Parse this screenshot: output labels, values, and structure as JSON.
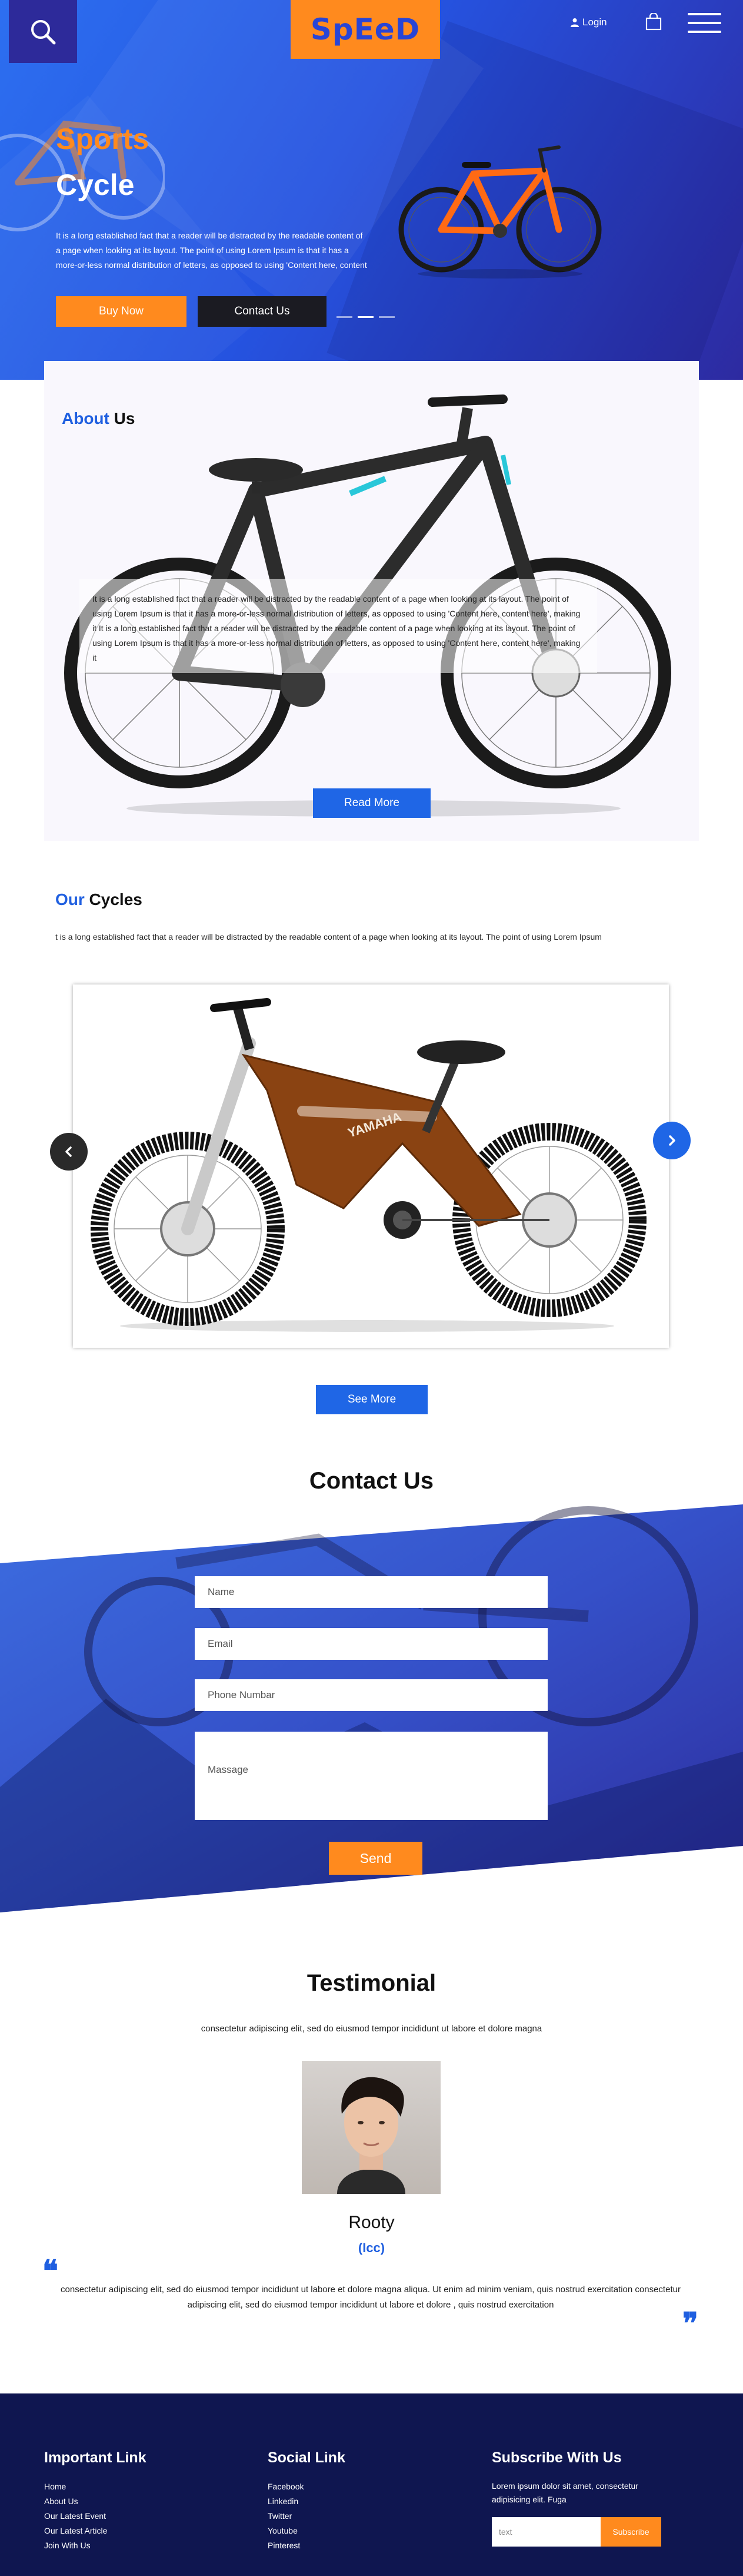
{
  "header": {
    "logo": "SpEeD",
    "login_label": "Login"
  },
  "hero": {
    "title_line1": "Sports",
    "title_line2": "Cycle",
    "description": "It is a long established fact that a reader will be distracted by the readable content of a page when looking at its layout. The point of using Lorem Ipsum is that it has a more-or-less normal distribution of letters, as opposed to using 'Content here, content",
    "buy_label": "Buy Now",
    "contact_label": "Contact Us"
  },
  "about": {
    "title_accent": "About",
    "title_rest": " Us",
    "text": "It is a long established fact that a reader will be distracted by the readable content of a page when looking at its layout. The point of using Lorem Ipsum is that it has a more-or-less normal distribution of letters, as opposed to using 'Content here, content here', making it It is a long established fact that a reader will be distracted by the readable content of a page when looking at its layout. The point of using Lorem Ipsum is that it has a more-or-less normal distribution of letters, as opposed to using 'Content here, content here', making it",
    "read_more_label": "Read More"
  },
  "cycles": {
    "title_accent": "Our",
    "title_rest": " Cycles",
    "text": "t is a long established fact that a reader will be distracted by the readable content of a page when looking at its layout. The point of using Lorem Ipsum",
    "bike_brand": "YAMAHA",
    "see_more_label": "See More"
  },
  "contact": {
    "title": "Contact Us",
    "name_placeholder": "Name",
    "email_placeholder": "Email",
    "phone_placeholder": "Phone Numbar",
    "message_placeholder": "Massage",
    "send_label": "Send"
  },
  "testimonial": {
    "title": "Testimonial",
    "subtitle": "consectetur adipiscing elit, sed do eiusmod tempor incididunt ut labore et dolore magna",
    "name": "Rooty",
    "role": "(Icc)",
    "text": "consectetur adipiscing elit, sed do eiusmod tempor incididunt ut labore et dolore magna aliqua. Ut enim ad minim veniam, quis nostrud exercitation consectetur adipiscing elit, sed do eiusmod tempor incididunt ut labore et dolore , quis nostrud exercitation"
  },
  "footer": {
    "important": {
      "heading": "Important Link",
      "links": [
        "Home",
        "About Us",
        "Our Latest Event",
        "Our Latest Article",
        "Join With Us"
      ]
    },
    "social": {
      "heading": "Social Link",
      "links": [
        "Facebook",
        "Linkedin",
        "Twitter",
        "Youtube",
        "Pinterest"
      ]
    },
    "subscribe": {
      "heading": "Subscribe With Us",
      "text": "Lorem ipsum dolor sit amet, consectetur adipisicing elit. Fuga",
      "input_placeholder": "text",
      "button_label": "Subscribe"
    }
  },
  "colors": {
    "primary_blue": "#1f66e6",
    "orange": "#ff8a1e",
    "footer_navy": "#0f1650"
  }
}
